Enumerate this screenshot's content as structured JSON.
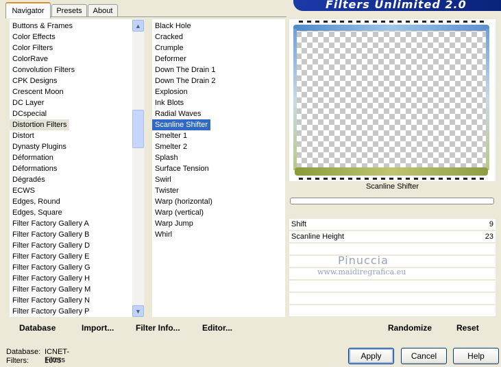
{
  "tabs": [
    {
      "label": "Navigator",
      "active": true
    },
    {
      "label": "Presets",
      "active": false
    },
    {
      "label": "About",
      "active": false
    }
  ],
  "banner_title": "Filters Unlimited 2.0",
  "categories": [
    "Buttons & Frames",
    "Color Effects",
    "Color Filters",
    "ColorRave",
    "Convolution Filters",
    "CPK Designs",
    "Crescent Moon",
    "DC Layer",
    "DCspecial",
    "Distortion Filters",
    "Distort",
    "Dynasty Plugins",
    "Déformation",
    "Déformations",
    "Dégradés",
    "ECWS",
    "Edges, Round",
    "Edges, Square",
    "Filter Factory Gallery A",
    "Filter Factory Gallery B",
    "Filter Factory Gallery D",
    "Filter Factory Gallery E",
    "Filter Factory Gallery G",
    "Filter Factory Gallery H",
    "Filter Factory Gallery M",
    "Filter Factory Gallery N",
    "Filter Factory Gallery P"
  ],
  "selected_category": "Distortion Filters",
  "filters": [
    "Black Hole",
    "Cracked",
    "Crumple",
    "Deformer",
    "Down The Drain 1",
    "Down The Drain 2",
    "Explosion",
    "Ink Blots",
    "Radial Waves",
    "Scanline Shifter",
    "Smelter 1",
    "Smelter 2",
    "Splash",
    "Surface Tension",
    "Swirl",
    "Twister",
    "Warp (horizontal)",
    "Warp (vertical)",
    "Warp Jump",
    "Whirl"
  ],
  "selected_filter": "Scanline Shifter",
  "toolbar": {
    "database": "Database",
    "import": "Import...",
    "filter_info": "Filter Info...",
    "editor": "Editor..."
  },
  "preview": {
    "filter_name": "Scanline Shifter"
  },
  "params": [
    {
      "label": "Shift",
      "value": "9"
    },
    {
      "label": "Scanline Height",
      "value": "23"
    },
    {
      "label": "",
      "value": ""
    },
    {
      "label": "",
      "value": ""
    },
    {
      "label": "",
      "value": ""
    },
    {
      "label": "",
      "value": ""
    },
    {
      "label": "",
      "value": ""
    },
    {
      "label": "",
      "value": ""
    }
  ],
  "watermark": {
    "name": "Pinuccia",
    "url": "www.maidiregrafica.eu"
  },
  "right_toolbar": {
    "randomize": "Randomize",
    "reset": "Reset"
  },
  "status": {
    "database_label": "Database:",
    "database_value": "ICNET-Filters",
    "filters_label": "Filters:",
    "filters_value": "1075"
  },
  "buttons": {
    "apply": "Apply",
    "cancel": "Cancel",
    "help": "Help"
  },
  "icons": {
    "scroll_up": "chevron-up-icon",
    "scroll_down": "chevron-down-icon"
  },
  "colors": {
    "selection": "#316ac5",
    "banner": "#0b2c8c",
    "tab_accent": "#e68b2c"
  }
}
